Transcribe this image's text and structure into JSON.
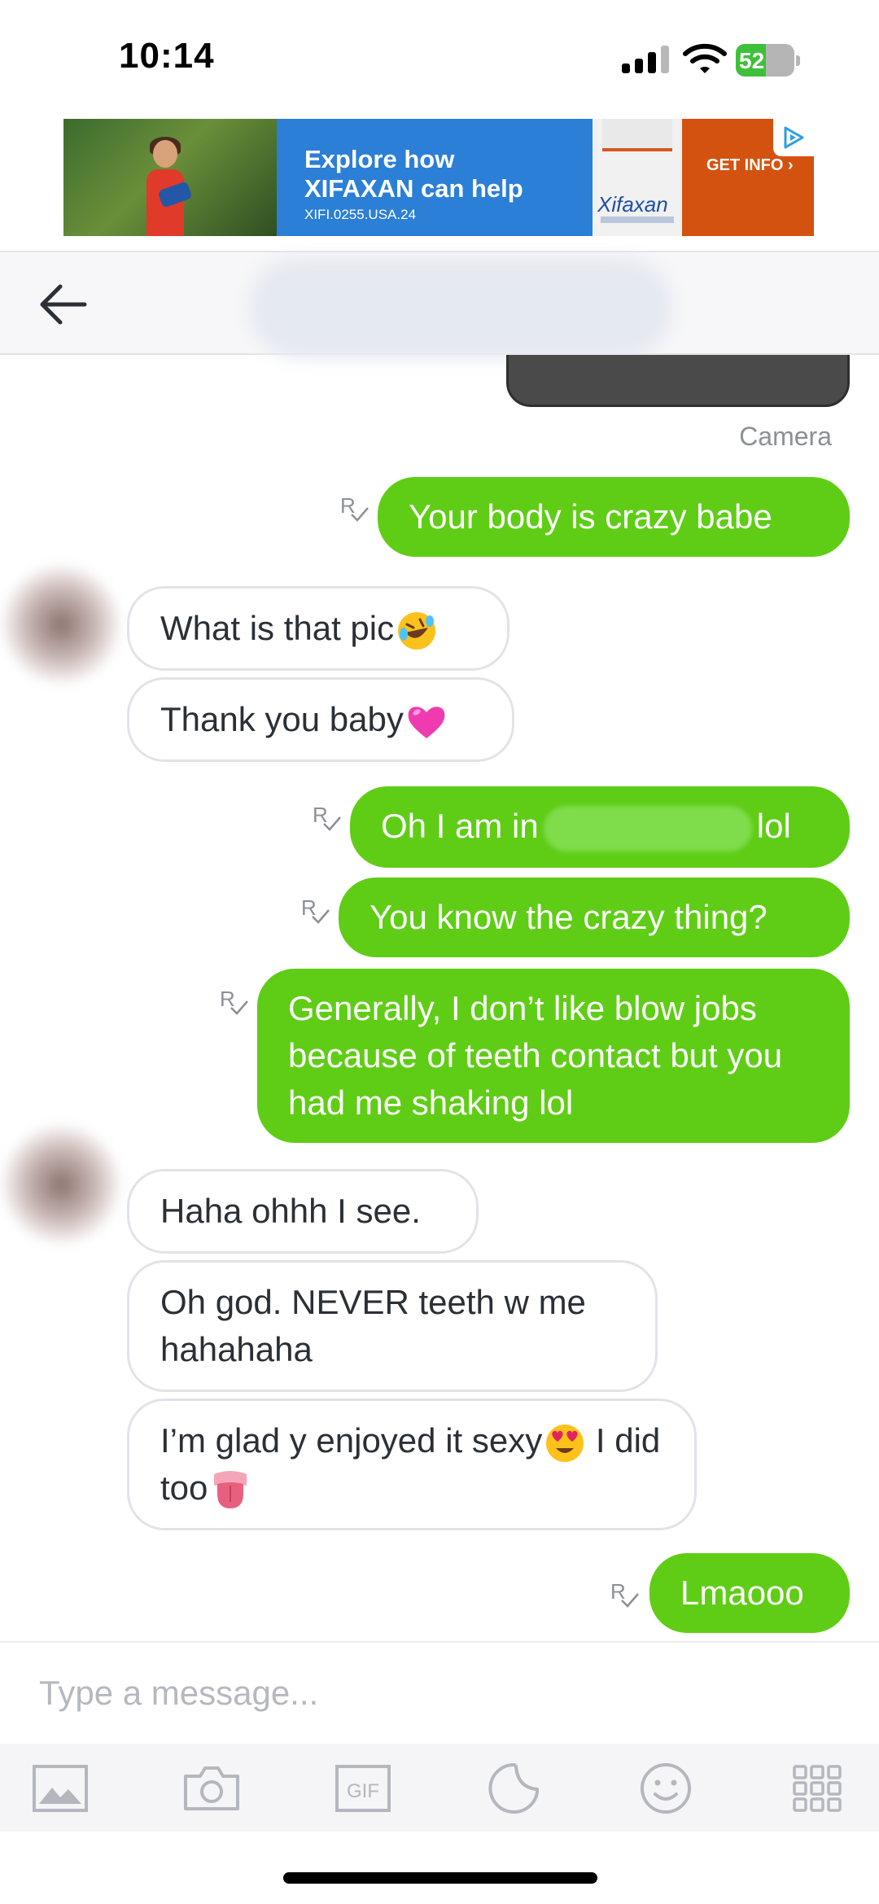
{
  "status_bar": {
    "time": "10:14",
    "battery_percent": "52",
    "battery_level": 0.52,
    "battery_color": "#3ec03a",
    "signal_bars_active": 3,
    "signal_bars_total": 4
  },
  "ad": {
    "headline_line1": "Explore how",
    "headline_line2": "XIFAXAN can help",
    "code": "XIFI.0255.USA.24",
    "product_label": "Xifaxan",
    "cta": "GET INFO ›",
    "background_color": "#2b7fd6",
    "cta_color": "#d4520f"
  },
  "header": {
    "back_icon": "arrow-left-icon",
    "contact_name": "████████"
  },
  "thread": {
    "media_caption": "Camera",
    "receipt_icon": "read-receipt-icon",
    "receipt_mark": "R",
    "outgoing_color": "#5fcd16",
    "messages": [
      {
        "direction": "out",
        "text": "Your body is crazy babe"
      },
      {
        "direction": "in",
        "text": "What is that pic",
        "emoji": "rolling-on-floor-laughing"
      },
      {
        "direction": "in",
        "text": "Thank you baby",
        "emoji": "pink-heart"
      },
      {
        "direction": "out",
        "text_before": "Oh I am in",
        "text_after": "lol"
      },
      {
        "direction": "out",
        "text": "You know the crazy thing?"
      },
      {
        "direction": "out",
        "text": "Generally, I don’t like blow jobs because of teeth contact but you had me shaking lol"
      },
      {
        "direction": "in",
        "text": "Haha ohhh I see."
      },
      {
        "direction": "in",
        "text": "Oh god. NEVER teeth w me hahahaha"
      },
      {
        "direction": "in",
        "text_before": "I’m glad y enjoyed it sexy",
        "text_middle": " I did too",
        "emoji_1": "heart-eyes",
        "emoji_2": "tongue"
      },
      {
        "direction": "out",
        "text": "Lmaooo"
      }
    ]
  },
  "composer": {
    "placeholder": "Type a message...",
    "value": ""
  },
  "toolbar": {
    "items": [
      "image-icon",
      "camera-icon",
      "gif-icon",
      "sticker-icon",
      "emoji-icon",
      "apps-grid-icon"
    ],
    "gif_label": "GIF"
  }
}
